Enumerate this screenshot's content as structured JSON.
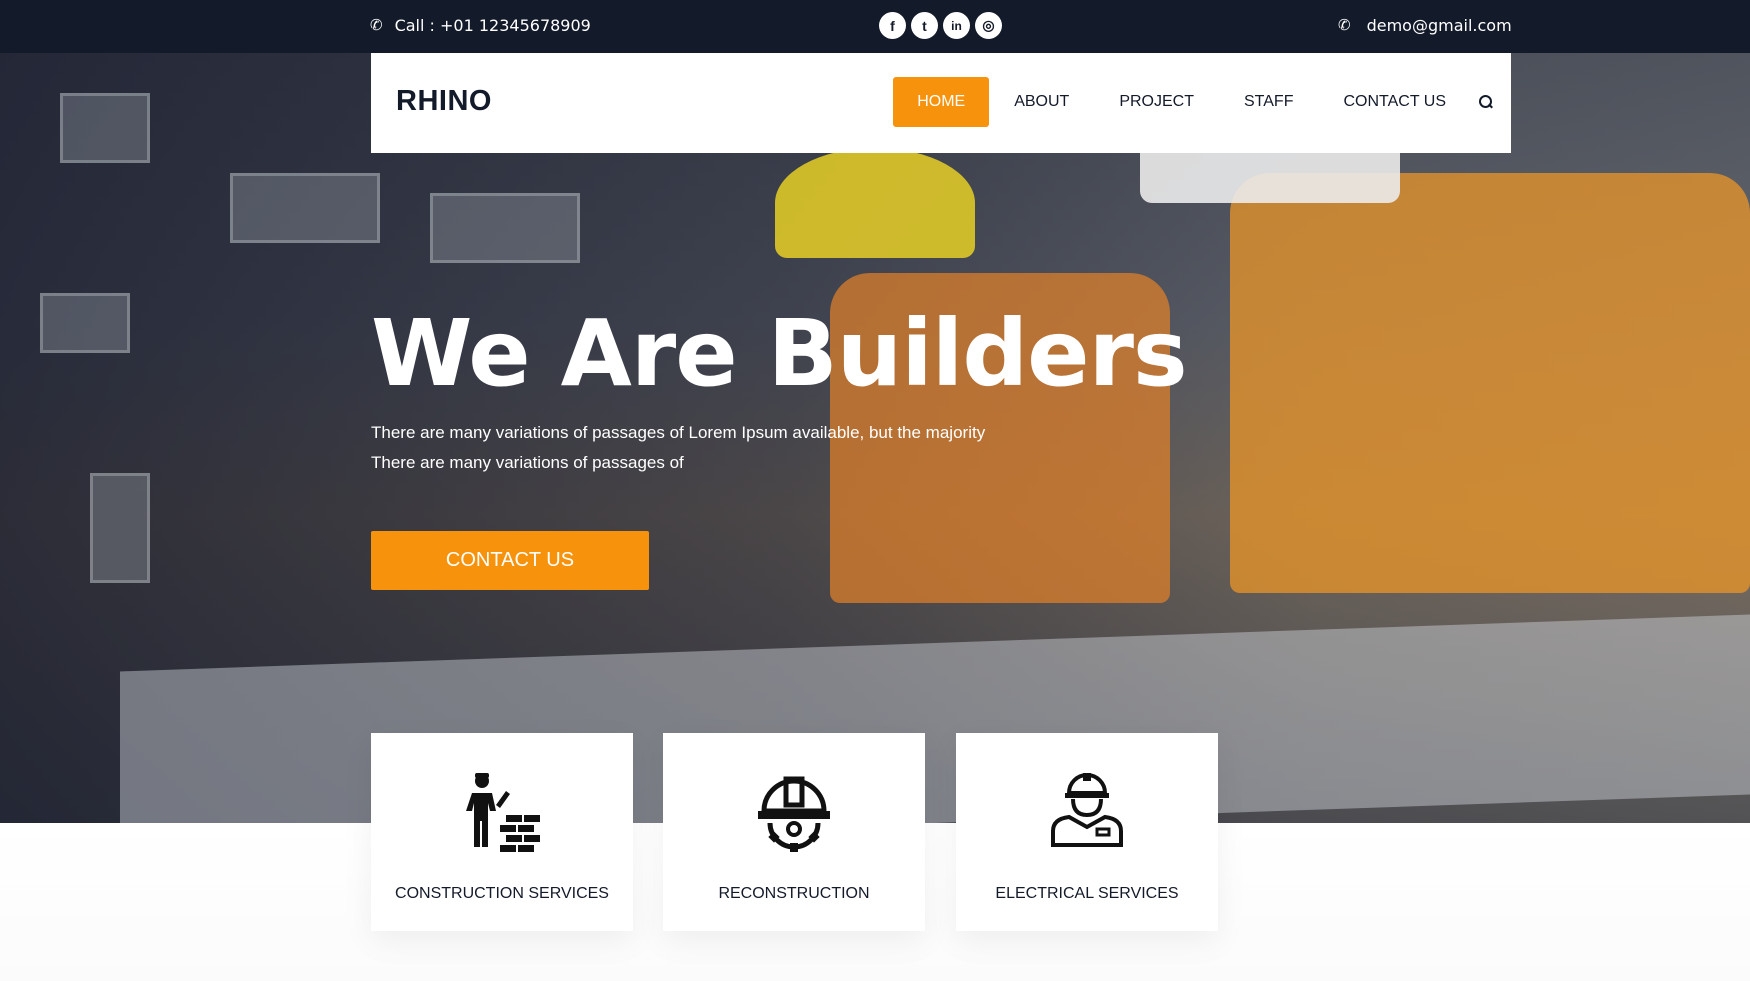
{
  "topbar": {
    "call": "Call : +01 12345678909",
    "email": "demo@gmail.com",
    "socials": [
      {
        "icon": "facebook-icon",
        "glyph": "f"
      },
      {
        "icon": "twitter-icon",
        "glyph": "t"
      },
      {
        "icon": "linkedin-icon",
        "glyph": "in"
      },
      {
        "icon": "instagram-icon",
        "glyph": "◎"
      }
    ]
  },
  "nav": {
    "brand": "RHINO",
    "items": [
      "HOME",
      "ABOUT",
      "PROJECT",
      "STAFF",
      "CONTACT US"
    ],
    "active_item": "HOME"
  },
  "hero": {
    "headline": "We Are Builders",
    "line1": "There are many variations of passages of Lorem Ipsum available, but the majority",
    "line2": "There are many variations of passages of",
    "cta": "CONTACT US"
  },
  "services": [
    {
      "label": "CONSTRUCTION SERVICES",
      "icon": "bricklayer-icon"
    },
    {
      "label": "RECONSTRUCTION",
      "icon": "helmet-gear-icon"
    },
    {
      "label": "ELECTRICAL SERVICES",
      "icon": "worker-icon"
    }
  ],
  "colors": {
    "accent": "#f7920c",
    "dark": "#131a2a"
  }
}
